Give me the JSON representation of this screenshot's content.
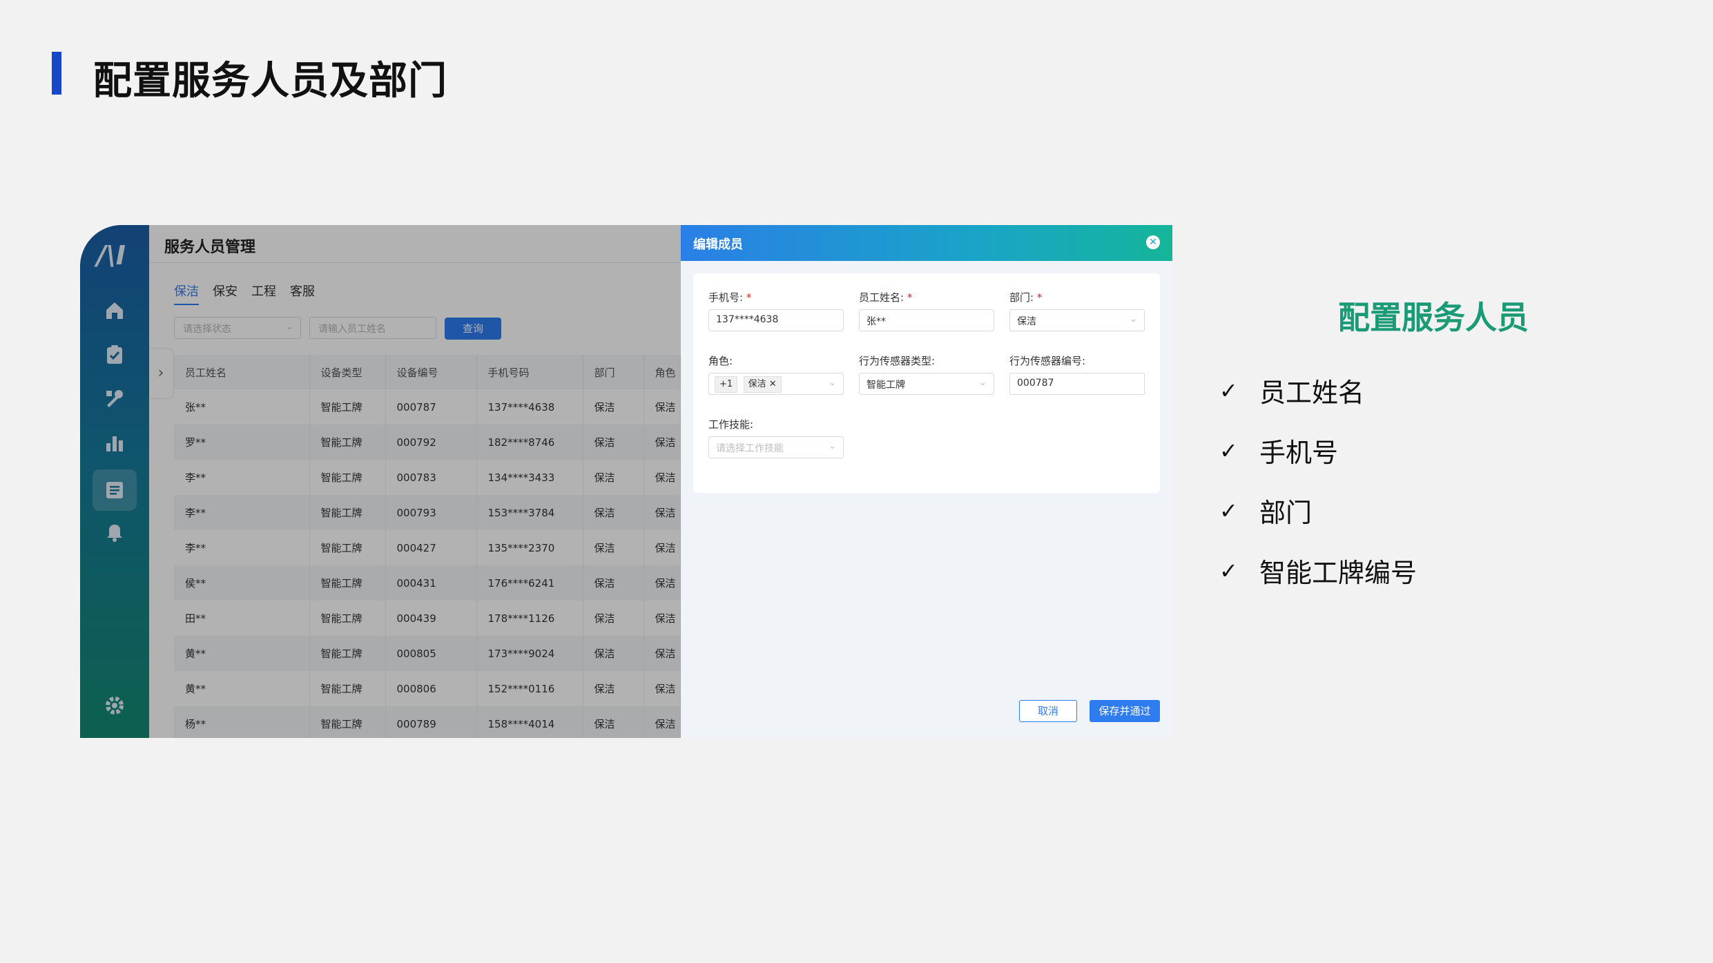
{
  "slide": {
    "title": "配置服务人员及部门"
  },
  "app": {
    "logo_text": "/\\I",
    "sidebar_icons": [
      "home-icon",
      "clipboard-check-icon",
      "tools-icon",
      "bar-chart-icon",
      "document-list-icon",
      "bell-icon",
      "gear-icon"
    ],
    "title": "服务人员管理",
    "tabs": [
      {
        "label": "保洁",
        "active": true
      },
      {
        "label": "保安",
        "active": false
      },
      {
        "label": "工程",
        "active": false
      },
      {
        "label": "客服",
        "active": false
      }
    ],
    "filter_status_placeholder": "请选择状态",
    "filter_name_placeholder": "请输入员工姓名",
    "query_button": "查询",
    "table": {
      "headers": [
        "员工姓名",
        "设备类型",
        "设备编号",
        "手机号码",
        "部门",
        "角色"
      ],
      "rows": [
        [
          "张**",
          "智能工牌",
          "000787",
          "137****4638",
          "保洁",
          "保洁"
        ],
        [
          "罗**",
          "智能工牌",
          "000792",
          "182****8746",
          "保洁",
          "保洁"
        ],
        [
          "李**",
          "智能工牌",
          "000783",
          "134****3433",
          "保洁",
          "保洁"
        ],
        [
          "李**",
          "智能工牌",
          "000793",
          "153****3784",
          "保洁",
          "保洁"
        ],
        [
          "李**",
          "智能工牌",
          "000427",
          "135****2370",
          "保洁",
          "保洁"
        ],
        [
          "侯**",
          "智能工牌",
          "000431",
          "176****6241",
          "保洁",
          "保洁"
        ],
        [
          "田**",
          "智能工牌",
          "000439",
          "178****1126",
          "保洁",
          "保洁"
        ],
        [
          "黄**",
          "智能工牌",
          "000805",
          "173****9024",
          "保洁",
          "保洁"
        ],
        [
          "黄**",
          "智能工牌",
          "000806",
          "152****0116",
          "保洁",
          "保洁"
        ],
        [
          "杨**",
          "智能工牌",
          "000789",
          "158****4014",
          "保洁",
          "保洁"
        ]
      ]
    }
  },
  "drawer": {
    "title": "编辑成员",
    "fields": {
      "phone_label": "手机号:",
      "phone_value": "137****4638",
      "name_label": "员工姓名:",
      "name_value": "张**",
      "dept_label": "部门:",
      "dept_value": "保洁",
      "role_label": "角色:",
      "role_more_tag": "+1",
      "role_tag": "保洁",
      "sensor_type_label": "行为传感器类型:",
      "sensor_type_value": "智能工牌",
      "sensor_no_label": "行为传感器编号:",
      "sensor_no_value": "000787",
      "skill_label": "工作技能:",
      "skill_placeholder": "请选择工作技能"
    },
    "required_mark": "*",
    "cancel_button": "取消",
    "save_button": "保存并通过"
  },
  "summary": {
    "heading": "配置服务人员",
    "check_mark": "✓",
    "items": [
      "员工姓名",
      "手机号",
      "部门",
      "智能工牌编号"
    ]
  },
  "colors": {
    "title_bar": "#1747c9",
    "accent_green": "#1a9a75",
    "primary_blue": "#2f7cf0"
  }
}
